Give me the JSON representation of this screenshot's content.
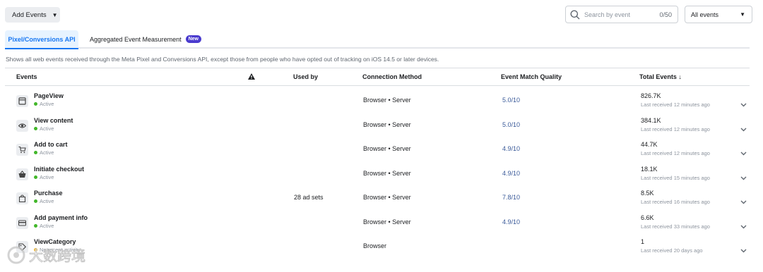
{
  "toolbar": {
    "add_events_label": "Add Events",
    "search_placeholder": "Search by event",
    "search_count": "0/50",
    "filter_value": "All events"
  },
  "tabs": [
    {
      "label": "Pixel/Conversions API",
      "active": true
    },
    {
      "label": "Aggregated Event Measurement",
      "badge": "New",
      "active": false
    }
  ],
  "description": "Shows all web events received through the Meta Pixel and Conversions API, except those from people who have opted out of tracking on iOS 14.5 or later devices.",
  "table": {
    "headers": {
      "events": "Events",
      "used_by": "Used by",
      "connection": "Connection Method",
      "match_quality": "Event Match Quality",
      "total": "Total Events ↓"
    },
    "rows": [
      {
        "name": "PageView",
        "icon": "page-icon",
        "status": "Active",
        "status_color": "#42b72a",
        "used_by": "",
        "connection": "Browser • Server",
        "emq": "5.0/10",
        "total": "826.7K",
        "last": "Last received 12 minutes ago"
      },
      {
        "name": "View content",
        "icon": "eye-icon",
        "status": "Active",
        "status_color": "#42b72a",
        "used_by": "",
        "connection": "Browser • Server",
        "emq": "5.0/10",
        "total": "384.1K",
        "last": "Last received 12 minutes ago"
      },
      {
        "name": "Add to cart",
        "icon": "cart-icon",
        "status": "Active",
        "status_color": "#42b72a",
        "used_by": "",
        "connection": "Browser • Server",
        "emq": "4.9/10",
        "total": "44.7K",
        "last": "Last received 12 minutes ago"
      },
      {
        "name": "Initiate checkout",
        "icon": "basket-icon",
        "status": "Active",
        "status_color": "#42b72a",
        "used_by": "",
        "connection": "Browser • Server",
        "emq": "4.9/10",
        "total": "18.1K",
        "last": "Last received 15 minutes ago"
      },
      {
        "name": "Purchase",
        "icon": "shopping-bag-icon",
        "status": "Active",
        "status_color": "#42b72a",
        "used_by": "28 ad sets",
        "connection": "Browser • Server",
        "emq": "7.8/10",
        "total": "8.5K",
        "last": "Last received 16 minutes ago"
      },
      {
        "name": "Add payment info",
        "icon": "credit-card-icon",
        "status": "Active",
        "status_color": "#42b72a",
        "used_by": "",
        "connection": "Browser • Server",
        "emq": "4.9/10",
        "total": "6.6K",
        "last": "Last received 33 minutes ago"
      },
      {
        "name": "ViewCategory",
        "icon": "tag-icon",
        "status": "No recent activity",
        "status_color": "#f7b928",
        "used_by": "",
        "connection": "Browser",
        "emq": "",
        "total": "1",
        "last": "Last received 20 days ago"
      }
    ]
  },
  "colors": {
    "accent": "#1877f2",
    "link": "#385898",
    "active_green": "#42b72a",
    "warning_yellow": "#f7b928",
    "badge_purple": "#4a3bce"
  },
  "watermark_text": "大数跨境"
}
